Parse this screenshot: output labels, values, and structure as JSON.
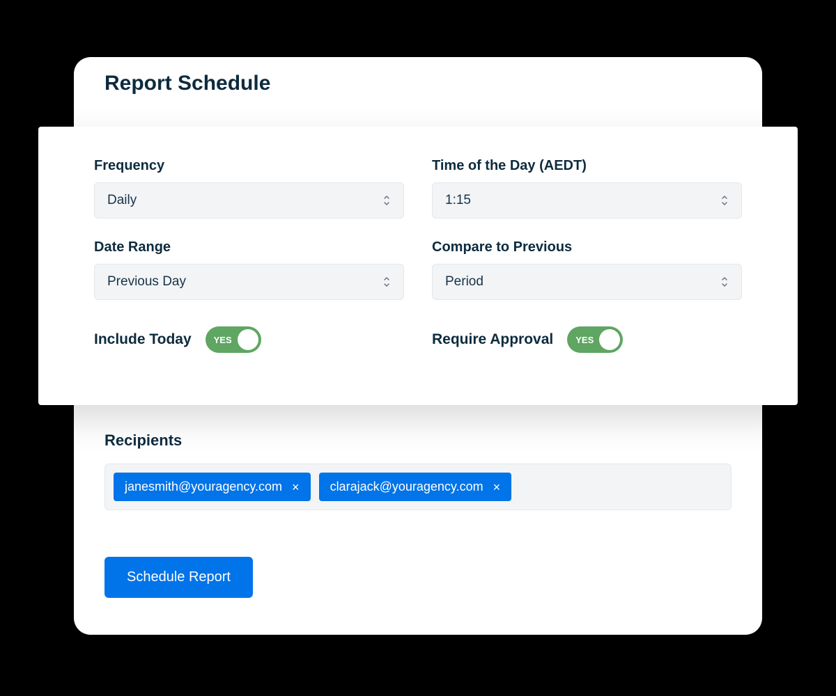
{
  "title": "Report Schedule",
  "fields": {
    "frequency": {
      "label": "Frequency",
      "value": "Daily"
    },
    "time_of_day": {
      "label": "Time of the Day (AEDT)",
      "value": "1:15"
    },
    "date_range": {
      "label": "Date Range",
      "value": "Previous Day"
    },
    "compare_to": {
      "label": "Compare to Previous",
      "value": "Period"
    },
    "include_today": {
      "label": "Include Today",
      "state": "YES"
    },
    "require_approval": {
      "label": "Require Approval",
      "state": "YES"
    }
  },
  "recipients": {
    "label": "Recipients",
    "items": [
      "janesmith@youragency.com",
      "clarajack@youragency.com"
    ]
  },
  "submit_button": "Schedule Report"
}
